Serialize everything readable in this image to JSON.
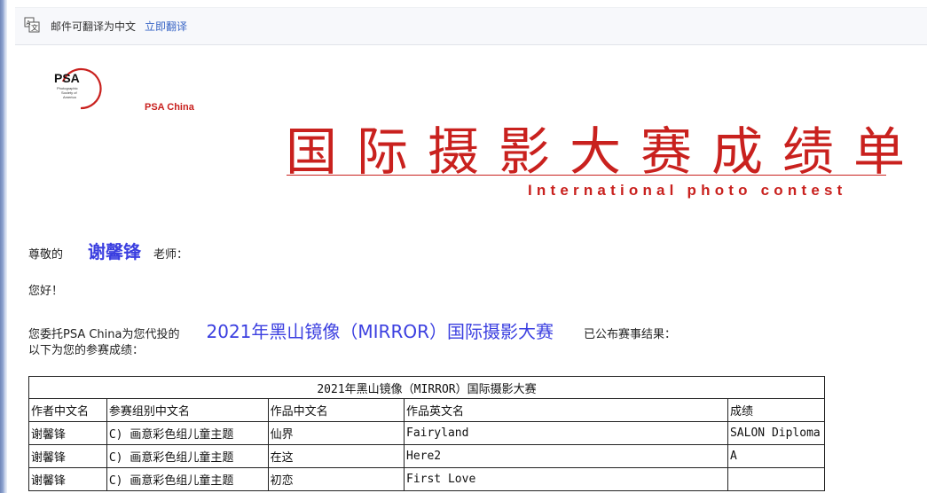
{
  "translate_bar": {
    "message": "邮件可翻译为中文",
    "action": "立即翻译"
  },
  "logo": {
    "mark": "PSA",
    "mark_sub": "Photographic Society of America",
    "name": "PSA China"
  },
  "header": {
    "title_cn": "国际摄影大赛成绩单",
    "title_en": "International photo contest"
  },
  "letter": {
    "salutation_prefix": "尊敬的",
    "recipient": "谢馨锋",
    "salutation_suffix": "老师：",
    "hello": "您好！",
    "entrust_prefix": "您委托PSA China为您代投的",
    "contest_name": "2021年黑山镜像（MIRROR）国际摄影大赛",
    "entrust_suffix": "已公布赛事结果：",
    "results_intro": "以下为您的参赛成绩："
  },
  "results_table": {
    "caption": "2021年黑山镜像（MIRROR）国际摄影大赛",
    "headers": [
      "作者中文名",
      "参赛组别中文名",
      "作品中文名",
      "作品英文名",
      "成绩"
    ],
    "rows": [
      [
        "谢馨锋",
        "C) 画意彩色组儿童主题",
        "仙界",
        "Fairyland",
        "SALON Diploma"
      ],
      [
        "谢馨锋",
        "C) 画意彩色组儿童主题",
        "在这",
        "Here2",
        "A"
      ],
      [
        "谢馨锋",
        "C) 画意彩色组儿童主题",
        "初恋",
        "First Love",
        ""
      ]
    ]
  },
  "colors": {
    "brand_red": "#c9211e",
    "highlight_blue": "#3b3fe0",
    "link_blue": "#3a66c6"
  }
}
